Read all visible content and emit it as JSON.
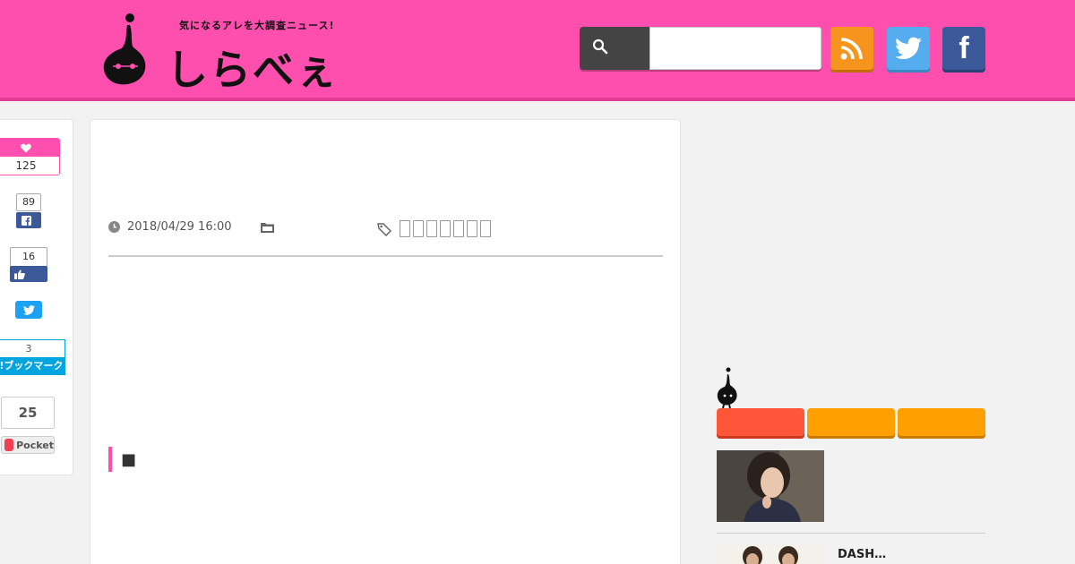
{
  "header": {
    "tagline": "気になるアレを大調査ニュース!",
    "logo_text": "しらべぇ",
    "search": {
      "value": "",
      "placeholder": ""
    },
    "colors": {
      "brand_pink": "#ff4fae",
      "rss": "#f7941d",
      "twitter": "#55acee",
      "facebook": "#3b5998"
    },
    "social": [
      {
        "name": "rss",
        "icon": "rss-icon"
      },
      {
        "name": "twitter",
        "icon": "twitter-bird-icon"
      },
      {
        "name": "facebook",
        "icon": "facebook-f-icon",
        "glyph": "f"
      }
    ]
  },
  "share": {
    "like_count": "125",
    "facebook_share_count": "89",
    "facebook_like_count": "16",
    "hatena_count": "3",
    "hatena_label": "B!ブックマーク",
    "pocket_count": "25",
    "pocket_label": "Pocket"
  },
  "article": {
    "date": "2018/04/29 16:00",
    "tag_placeholder_count": 7,
    "section_heading": "■"
  },
  "sidebar": {
    "tabs": [
      {
        "color": "#ff5539"
      },
      {
        "color": "#ffa000"
      },
      {
        "color": "#ffa000"
      }
    ],
    "list": [
      {
        "title": ""
      },
      {
        "title": "DASH…"
      }
    ]
  }
}
